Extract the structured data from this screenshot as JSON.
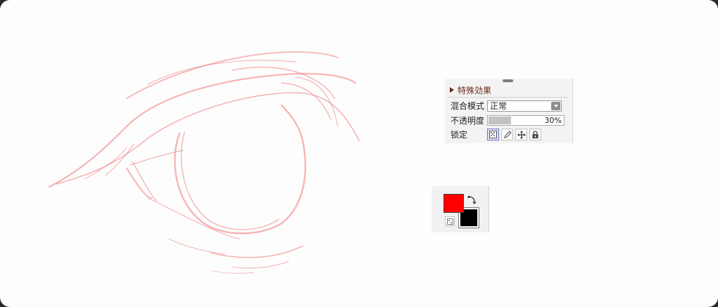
{
  "special_effects": {
    "title": "特殊効果",
    "blend_mode": {
      "label": "混合模式",
      "value": "正常"
    },
    "opacity": {
      "label": "不透明度",
      "value": "30%",
      "level": 0.3
    },
    "lock": {
      "label": "锁定",
      "icons": [
        "lock-transparent-icon",
        "lock-paint-icon",
        "lock-move-icon",
        "lock-all-icon"
      ],
      "active": "lock-transparent-icon"
    }
  },
  "colors": {
    "foreground": "#ff0000",
    "background": "#000000",
    "sketch_stroke": "#f08080"
  }
}
